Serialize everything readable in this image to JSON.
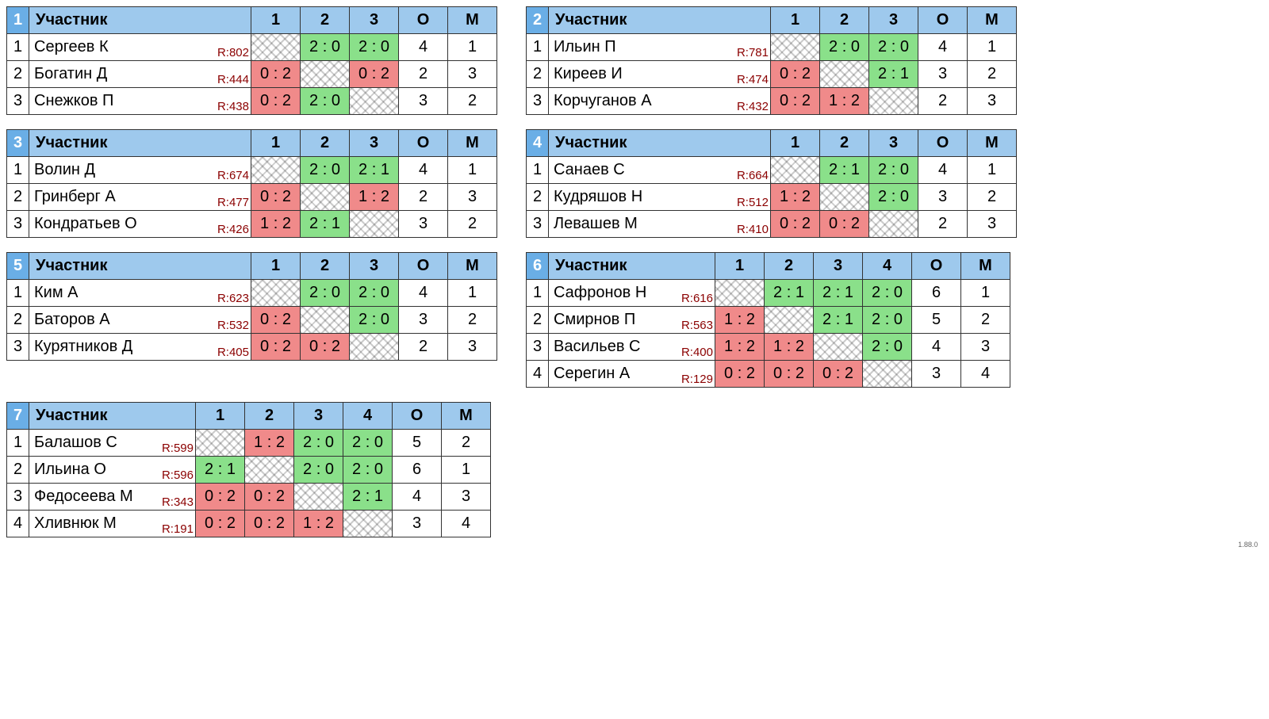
{
  "labels": {
    "participant": "Участник",
    "points": "О",
    "place": "М"
  },
  "version": "1.88.0",
  "groups": [
    {
      "num": "1",
      "nameColWidth": 280,
      "cols": [
        "1",
        "2",
        "3"
      ],
      "players": [
        {
          "n": "1",
          "name": "Сергеев К",
          "rating": "R:802",
          "cells": [
            {
              "t": "diag"
            },
            {
              "t": "win",
              "s": "2 : 0"
            },
            {
              "t": "win",
              "s": "2 : 0"
            }
          ],
          "o": "4",
          "m": "1"
        },
        {
          "n": "2",
          "name": "Богатин Д",
          "rating": "R:444",
          "cells": [
            {
              "t": "lose",
              "s": "0 : 2"
            },
            {
              "t": "diag"
            },
            {
              "t": "lose",
              "s": "0 : 2"
            }
          ],
          "o": "2",
          "m": "3"
        },
        {
          "n": "3",
          "name": "Снежков П",
          "rating": "R:438",
          "cells": [
            {
              "t": "lose",
              "s": "0 : 2"
            },
            {
              "t": "win",
              "s": "2 : 0"
            },
            {
              "t": "diag"
            }
          ],
          "o": "3",
          "m": "2"
        }
      ]
    },
    {
      "num": "2",
      "nameColWidth": 280,
      "cols": [
        "1",
        "2",
        "3"
      ],
      "players": [
        {
          "n": "1",
          "name": "Ильин П",
          "rating": "R:781",
          "cells": [
            {
              "t": "diag"
            },
            {
              "t": "win",
              "s": "2 : 0"
            },
            {
              "t": "win",
              "s": "2 : 0"
            }
          ],
          "o": "4",
          "m": "1"
        },
        {
          "n": "2",
          "name": "Киреев И",
          "rating": "R:474",
          "cells": [
            {
              "t": "lose",
              "s": "0 : 2"
            },
            {
              "t": "diag"
            },
            {
              "t": "win",
              "s": "2 : 1"
            }
          ],
          "o": "3",
          "m": "2"
        },
        {
          "n": "3",
          "name": "Корчуганов А",
          "rating": "R:432",
          "cells": [
            {
              "t": "lose",
              "s": "0 : 2"
            },
            {
              "t": "lose",
              "s": "1 : 2"
            },
            {
              "t": "diag"
            }
          ],
          "o": "2",
          "m": "3"
        }
      ]
    },
    {
      "num": "3",
      "nameColWidth": 280,
      "cols": [
        "1",
        "2",
        "3"
      ],
      "players": [
        {
          "n": "1",
          "name": "Волин Д",
          "rating": "R:674",
          "cells": [
            {
              "t": "diag"
            },
            {
              "t": "win",
              "s": "2 : 0"
            },
            {
              "t": "win",
              "s": "2 : 1"
            }
          ],
          "o": "4",
          "m": "1"
        },
        {
          "n": "2",
          "name": "Гринберг А",
          "rating": "R:477",
          "cells": [
            {
              "t": "lose",
              "s": "0 : 2"
            },
            {
              "t": "diag"
            },
            {
              "t": "lose",
              "s": "1 : 2"
            }
          ],
          "o": "2",
          "m": "3"
        },
        {
          "n": "3",
          "name": "Кондратьев О",
          "rating": "R:426",
          "cells": [
            {
              "t": "lose",
              "s": "1 : 2"
            },
            {
              "t": "win",
              "s": "2 : 1"
            },
            {
              "t": "diag"
            }
          ],
          "o": "3",
          "m": "2"
        }
      ]
    },
    {
      "num": "4",
      "nameColWidth": 280,
      "cols": [
        "1",
        "2",
        "3"
      ],
      "players": [
        {
          "n": "1",
          "name": "Санаев С",
          "rating": "R:664",
          "cells": [
            {
              "t": "diag"
            },
            {
              "t": "win",
              "s": "2 : 1"
            },
            {
              "t": "win",
              "s": "2 : 0"
            }
          ],
          "o": "4",
          "m": "1"
        },
        {
          "n": "2",
          "name": "Кудряшов Н",
          "rating": "R:512",
          "cells": [
            {
              "t": "lose",
              "s": "1 : 2"
            },
            {
              "t": "diag"
            },
            {
              "t": "win",
              "s": "2 : 0"
            }
          ],
          "o": "3",
          "m": "2"
        },
        {
          "n": "3",
          "name": "Левашев М",
          "rating": "R:410",
          "cells": [
            {
              "t": "lose",
              "s": "0 : 2"
            },
            {
              "t": "lose",
              "s": "0 : 2"
            },
            {
              "t": "diag"
            }
          ],
          "o": "2",
          "m": "3"
        }
      ]
    },
    {
      "num": "5",
      "nameColWidth": 280,
      "cols": [
        "1",
        "2",
        "3"
      ],
      "players": [
        {
          "n": "1",
          "name": "Ким А",
          "rating": "R:623",
          "cells": [
            {
              "t": "diag"
            },
            {
              "t": "win",
              "s": "2 : 0"
            },
            {
              "t": "win",
              "s": "2 : 0"
            }
          ],
          "o": "4",
          "m": "1"
        },
        {
          "n": "2",
          "name": "Баторов А",
          "rating": "R:532",
          "cells": [
            {
              "t": "lose",
              "s": "0 : 2"
            },
            {
              "t": "diag"
            },
            {
              "t": "win",
              "s": "2 : 0"
            }
          ],
          "o": "3",
          "m": "2"
        },
        {
          "n": "3",
          "name": "Курятников Д",
          "rating": "R:405",
          "cells": [
            {
              "t": "lose",
              "s": "0 : 2"
            },
            {
              "t": "lose",
              "s": "0 : 2"
            },
            {
              "t": "diag"
            }
          ],
          "o": "2",
          "m": "3"
        }
      ]
    },
    {
      "num": "6",
      "nameColWidth": 210,
      "cols": [
        "1",
        "2",
        "3",
        "4"
      ],
      "players": [
        {
          "n": "1",
          "name": "Сафронов Н",
          "rating": "R:616",
          "cells": [
            {
              "t": "diag"
            },
            {
              "t": "win",
              "s": "2 : 1"
            },
            {
              "t": "win",
              "s": "2 : 1"
            },
            {
              "t": "win",
              "s": "2 : 0"
            }
          ],
          "o": "6",
          "m": "1"
        },
        {
          "n": "2",
          "name": "Смирнов П",
          "rating": "R:563",
          "cells": [
            {
              "t": "lose",
              "s": "1 : 2"
            },
            {
              "t": "diag"
            },
            {
              "t": "win",
              "s": "2 : 1"
            },
            {
              "t": "win",
              "s": "2 : 0"
            }
          ],
          "o": "5",
          "m": "2"
        },
        {
          "n": "3",
          "name": "Васильев С",
          "rating": "R:400",
          "cells": [
            {
              "t": "lose",
              "s": "1 : 2"
            },
            {
              "t": "lose",
              "s": "1 : 2"
            },
            {
              "t": "diag"
            },
            {
              "t": "win",
              "s": "2 : 0"
            }
          ],
          "o": "4",
          "m": "3"
        },
        {
          "n": "4",
          "name": "Серегин А",
          "rating": "R:129",
          "cells": [
            {
              "t": "lose",
              "s": "0 : 2"
            },
            {
              "t": "lose",
              "s": "0 : 2"
            },
            {
              "t": "lose",
              "s": "0 : 2"
            },
            {
              "t": "diag"
            }
          ],
          "o": "3",
          "m": "4"
        }
      ]
    },
    {
      "num": "7",
      "nameColWidth": 210,
      "cols": [
        "1",
        "2",
        "3",
        "4"
      ],
      "players": [
        {
          "n": "1",
          "name": "Балашов С",
          "rating": "R:599",
          "cells": [
            {
              "t": "diag"
            },
            {
              "t": "lose",
              "s": "1 : 2"
            },
            {
              "t": "win",
              "s": "2 : 0"
            },
            {
              "t": "win",
              "s": "2 : 0"
            }
          ],
          "o": "5",
          "m": "2"
        },
        {
          "n": "2",
          "name": "Ильина О",
          "rating": "R:596",
          "cells": [
            {
              "t": "win",
              "s": "2 : 1"
            },
            {
              "t": "diag"
            },
            {
              "t": "win",
              "s": "2 : 0"
            },
            {
              "t": "win",
              "s": "2 : 0"
            }
          ],
          "o": "6",
          "m": "1"
        },
        {
          "n": "3",
          "name": "Федосеева М",
          "rating": "R:343",
          "cells": [
            {
              "t": "lose",
              "s": "0 : 2"
            },
            {
              "t": "lose",
              "s": "0 : 2"
            },
            {
              "t": "diag"
            },
            {
              "t": "win",
              "s": "2 : 1"
            }
          ],
          "o": "4",
          "m": "3"
        },
        {
          "n": "4",
          "name": "Хливнюк М",
          "rating": "R:191",
          "cells": [
            {
              "t": "lose",
              "s": "0 : 2"
            },
            {
              "t": "lose",
              "s": "0 : 2"
            },
            {
              "t": "lose",
              "s": "1 : 2"
            },
            {
              "t": "diag"
            }
          ],
          "o": "3",
          "m": "4"
        }
      ]
    }
  ]
}
